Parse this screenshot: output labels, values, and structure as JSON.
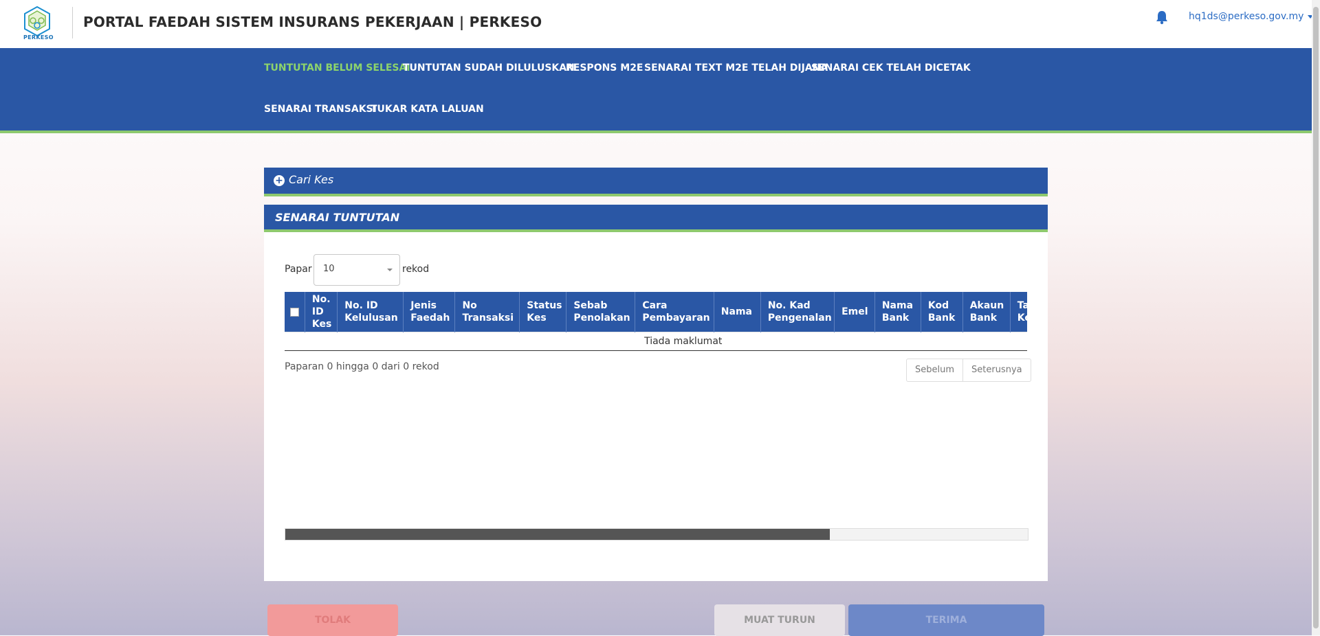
{
  "header": {
    "logo_text": "PERKESO",
    "title": "PORTAL FAEDAH SISTEM INSURANS PEKERJAAN | PERKESO",
    "user_email": "hq1ds@perkeso.gov.my"
  },
  "nav": {
    "items": [
      {
        "label": "TUNTUTAN BELUM SELESAI",
        "active": true
      },
      {
        "label": "TUNTUTAN SUDAH DILULUSKAN"
      },
      {
        "label": "RESPONS M2E"
      },
      {
        "label": "SENARAI TEXT M2E TELAH DIJANA"
      },
      {
        "label": "SENARAI CEK TELAH DICETAK"
      },
      {
        "label": "SENARAI TRANSAKSI"
      },
      {
        "label": "TUKAR KATA LALUAN"
      }
    ]
  },
  "search_panel": {
    "title": "Cari Kes"
  },
  "list": {
    "title": "SENARAI TUNTUTAN",
    "length_prefix": "Papar",
    "length_value": "10",
    "length_suffix": "rekod",
    "columns": [
      "No. ID Kes",
      "No. ID Kelulusan",
      "Jenis Faedah",
      "No Transaksi",
      "Status Kes",
      "Sebab Penolakan",
      "Cara Pembayaran",
      "Nama",
      "No. Kad Pengenalan",
      "Emel",
      "Nama Bank",
      "Kod Bank",
      "Akaun Bank",
      "Tarikh Kelulusan"
    ],
    "empty_text": "Tiada maklumat",
    "info": "Paparan 0 hingga 0 dari 0 rekod",
    "prev_label": "Sebelum",
    "next_label": "Seterusnya",
    "hscroll_fraction": 0.733
  },
  "actions": {
    "reject_label": "TOLAK",
    "download_label": "MUAT TURUN",
    "accept_label": "TERIMA"
  },
  "colors": {
    "primary": "#2a57a5",
    "accent_green": "#8dc96e",
    "active_nav": "#8dd46b"
  }
}
